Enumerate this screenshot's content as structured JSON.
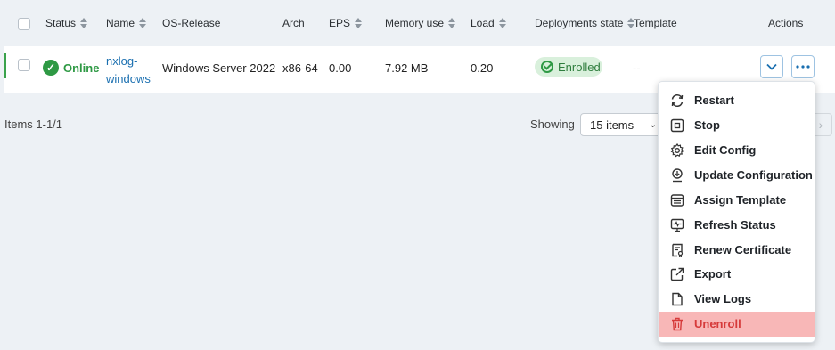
{
  "table": {
    "columns": [
      "Status",
      "Name",
      "OS-Release",
      "Arch",
      "EPS",
      "Memory use",
      "Load",
      "Deployments state",
      "Template",
      "Actions"
    ],
    "rows": [
      {
        "status": "Online",
        "name_line1": "nxlog-",
        "name_line2": "windows",
        "os_release": "Windows Server 2022",
        "arch": "x86-64",
        "eps": "0.00",
        "memory": "7.92 MB",
        "load": "0.20",
        "deployment_state": "Enrolled",
        "template": "--"
      }
    ]
  },
  "footer": {
    "items_count": "Items 1-1/1",
    "showing_label": "Showing",
    "page_size": "15 items"
  },
  "actions_menu": {
    "items": [
      {
        "label": "Restart",
        "icon": "restart-icon"
      },
      {
        "label": "Stop",
        "icon": "stop-icon"
      },
      {
        "label": "Edit Config",
        "icon": "gear-icon"
      },
      {
        "label": "Update Configuration",
        "icon": "update-config-icon"
      },
      {
        "label": "Assign Template",
        "icon": "template-icon"
      },
      {
        "label": "Refresh Status",
        "icon": "monitor-pulse-icon"
      },
      {
        "label": "Renew Certificate",
        "icon": "certificate-icon"
      },
      {
        "label": "Export",
        "icon": "export-icon"
      },
      {
        "label": "View Logs",
        "icon": "file-icon"
      },
      {
        "label": "Unenroll",
        "icon": "trash-icon",
        "danger": true
      }
    ]
  },
  "colors": {
    "online": "#2e9944",
    "link": "#1a6fb0",
    "danger_bg": "#f8b7b7",
    "danger_text": "#d63a3a"
  }
}
